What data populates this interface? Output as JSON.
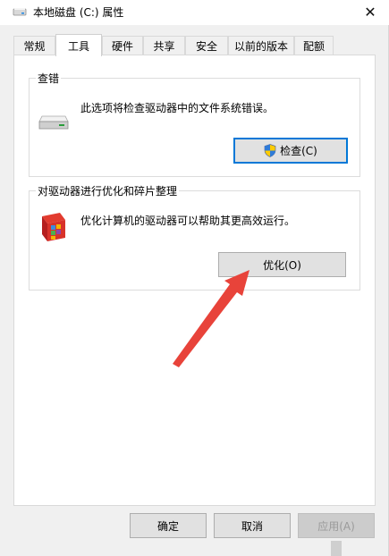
{
  "window": {
    "title": "本地磁盘 (C:) 属性",
    "close_glyph": "✕",
    "title_icon": "drive-icon"
  },
  "tabs": [
    {
      "label": "常规"
    },
    {
      "label": "工具"
    },
    {
      "label": "硬件"
    },
    {
      "label": "共享"
    },
    {
      "label": "安全"
    },
    {
      "label": "以前的版本"
    },
    {
      "label": "配额"
    }
  ],
  "active_tab": "工具",
  "error_check": {
    "title": "查错",
    "description": "此选项将检查驱动器中的文件系统错误。",
    "button_label": "检查(C)",
    "icon": "drive-icon"
  },
  "optimize": {
    "title": "对驱动器进行优化和碎片整理",
    "description": "优化计算机的驱动器可以帮助其更高效运行。",
    "button_label": "优化(O)",
    "icon": "defrag-icon"
  },
  "footer": {
    "ok_label": "确定",
    "cancel_label": "取消",
    "apply_label": "应用(A)"
  },
  "colors": {
    "focus_border": "#0078d7",
    "arrow": "#e8433a"
  }
}
